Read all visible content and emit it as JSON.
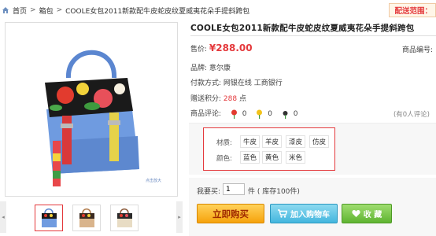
{
  "breadcrumb": {
    "home": "首页",
    "separator": ">",
    "category": "箱包",
    "current": "COOLE女包2011新款配牛皮蛇皮纹夏威夷花朵手提斜跨包"
  },
  "delivery": "配送范围：",
  "gallery": {
    "zoom_note": "点击放大",
    "prev": "◂",
    "next": "▸"
  },
  "product": {
    "title": "COOLE女包2011新款配牛皮蛇皮纹夏威夷花朵手提斜跨包",
    "price_label": "售价:",
    "price": "¥288.00",
    "item_no_label": "商品编号:",
    "brand_label": "品牌:",
    "brand": "意尔康",
    "payment_label": "付款方式:",
    "payment": "网银在线 工商银行",
    "points_label": "赠送积分:",
    "points": "288",
    "points_unit": "点",
    "rating_label": "商品评论:",
    "ratings": [
      "0",
      "0",
      "0"
    ],
    "review_link": "(有0人评论)"
  },
  "options": {
    "material_label": "材质:",
    "materials": [
      "牛皮",
      "羊皮",
      "漆皮",
      "仿皮"
    ],
    "color_label": "颜色:",
    "colors": [
      "蓝色",
      "黄色",
      "米色"
    ]
  },
  "purchase": {
    "qty_label": "我要买:",
    "qty": "1",
    "qty_unit": "件 ( 库存100件)",
    "buy_label": "立即购买",
    "cart_label": "加入购物车",
    "fav_label": "收 藏"
  },
  "colors": {
    "accent": "#e4393c",
    "buy_orange": "#f6a20c",
    "cart_blue": "#43b6de",
    "fav_green": "#5fb431"
  }
}
